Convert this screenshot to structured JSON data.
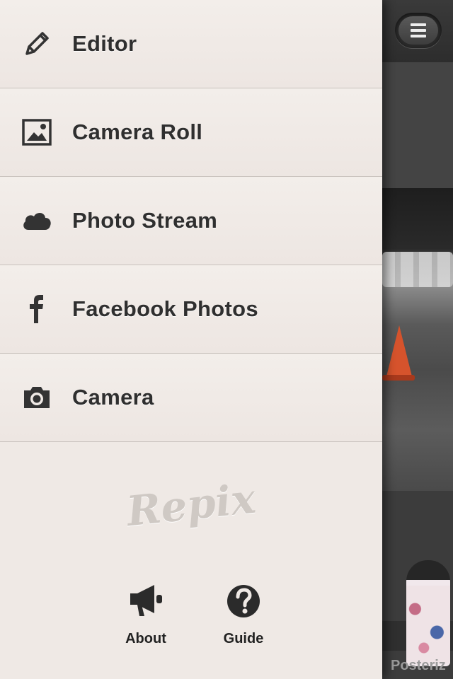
{
  "menu": {
    "items": [
      {
        "label": "Editor",
        "icon": "pencil-icon"
      },
      {
        "label": "Camera Roll",
        "icon": "image-icon"
      },
      {
        "label": "Photo Stream",
        "icon": "cloud-icon"
      },
      {
        "label": "Facebook Photos",
        "icon": "facebook-icon"
      },
      {
        "label": "Camera",
        "icon": "camera-icon"
      }
    ],
    "brand": "Repix",
    "about_label": "About",
    "guide_label": "Guide"
  },
  "background": {
    "filter_label": "Posteriz"
  },
  "colors": {
    "panel": "#efe9e5",
    "text": "#2f2f2f",
    "divider": "#c9c2bd"
  }
}
